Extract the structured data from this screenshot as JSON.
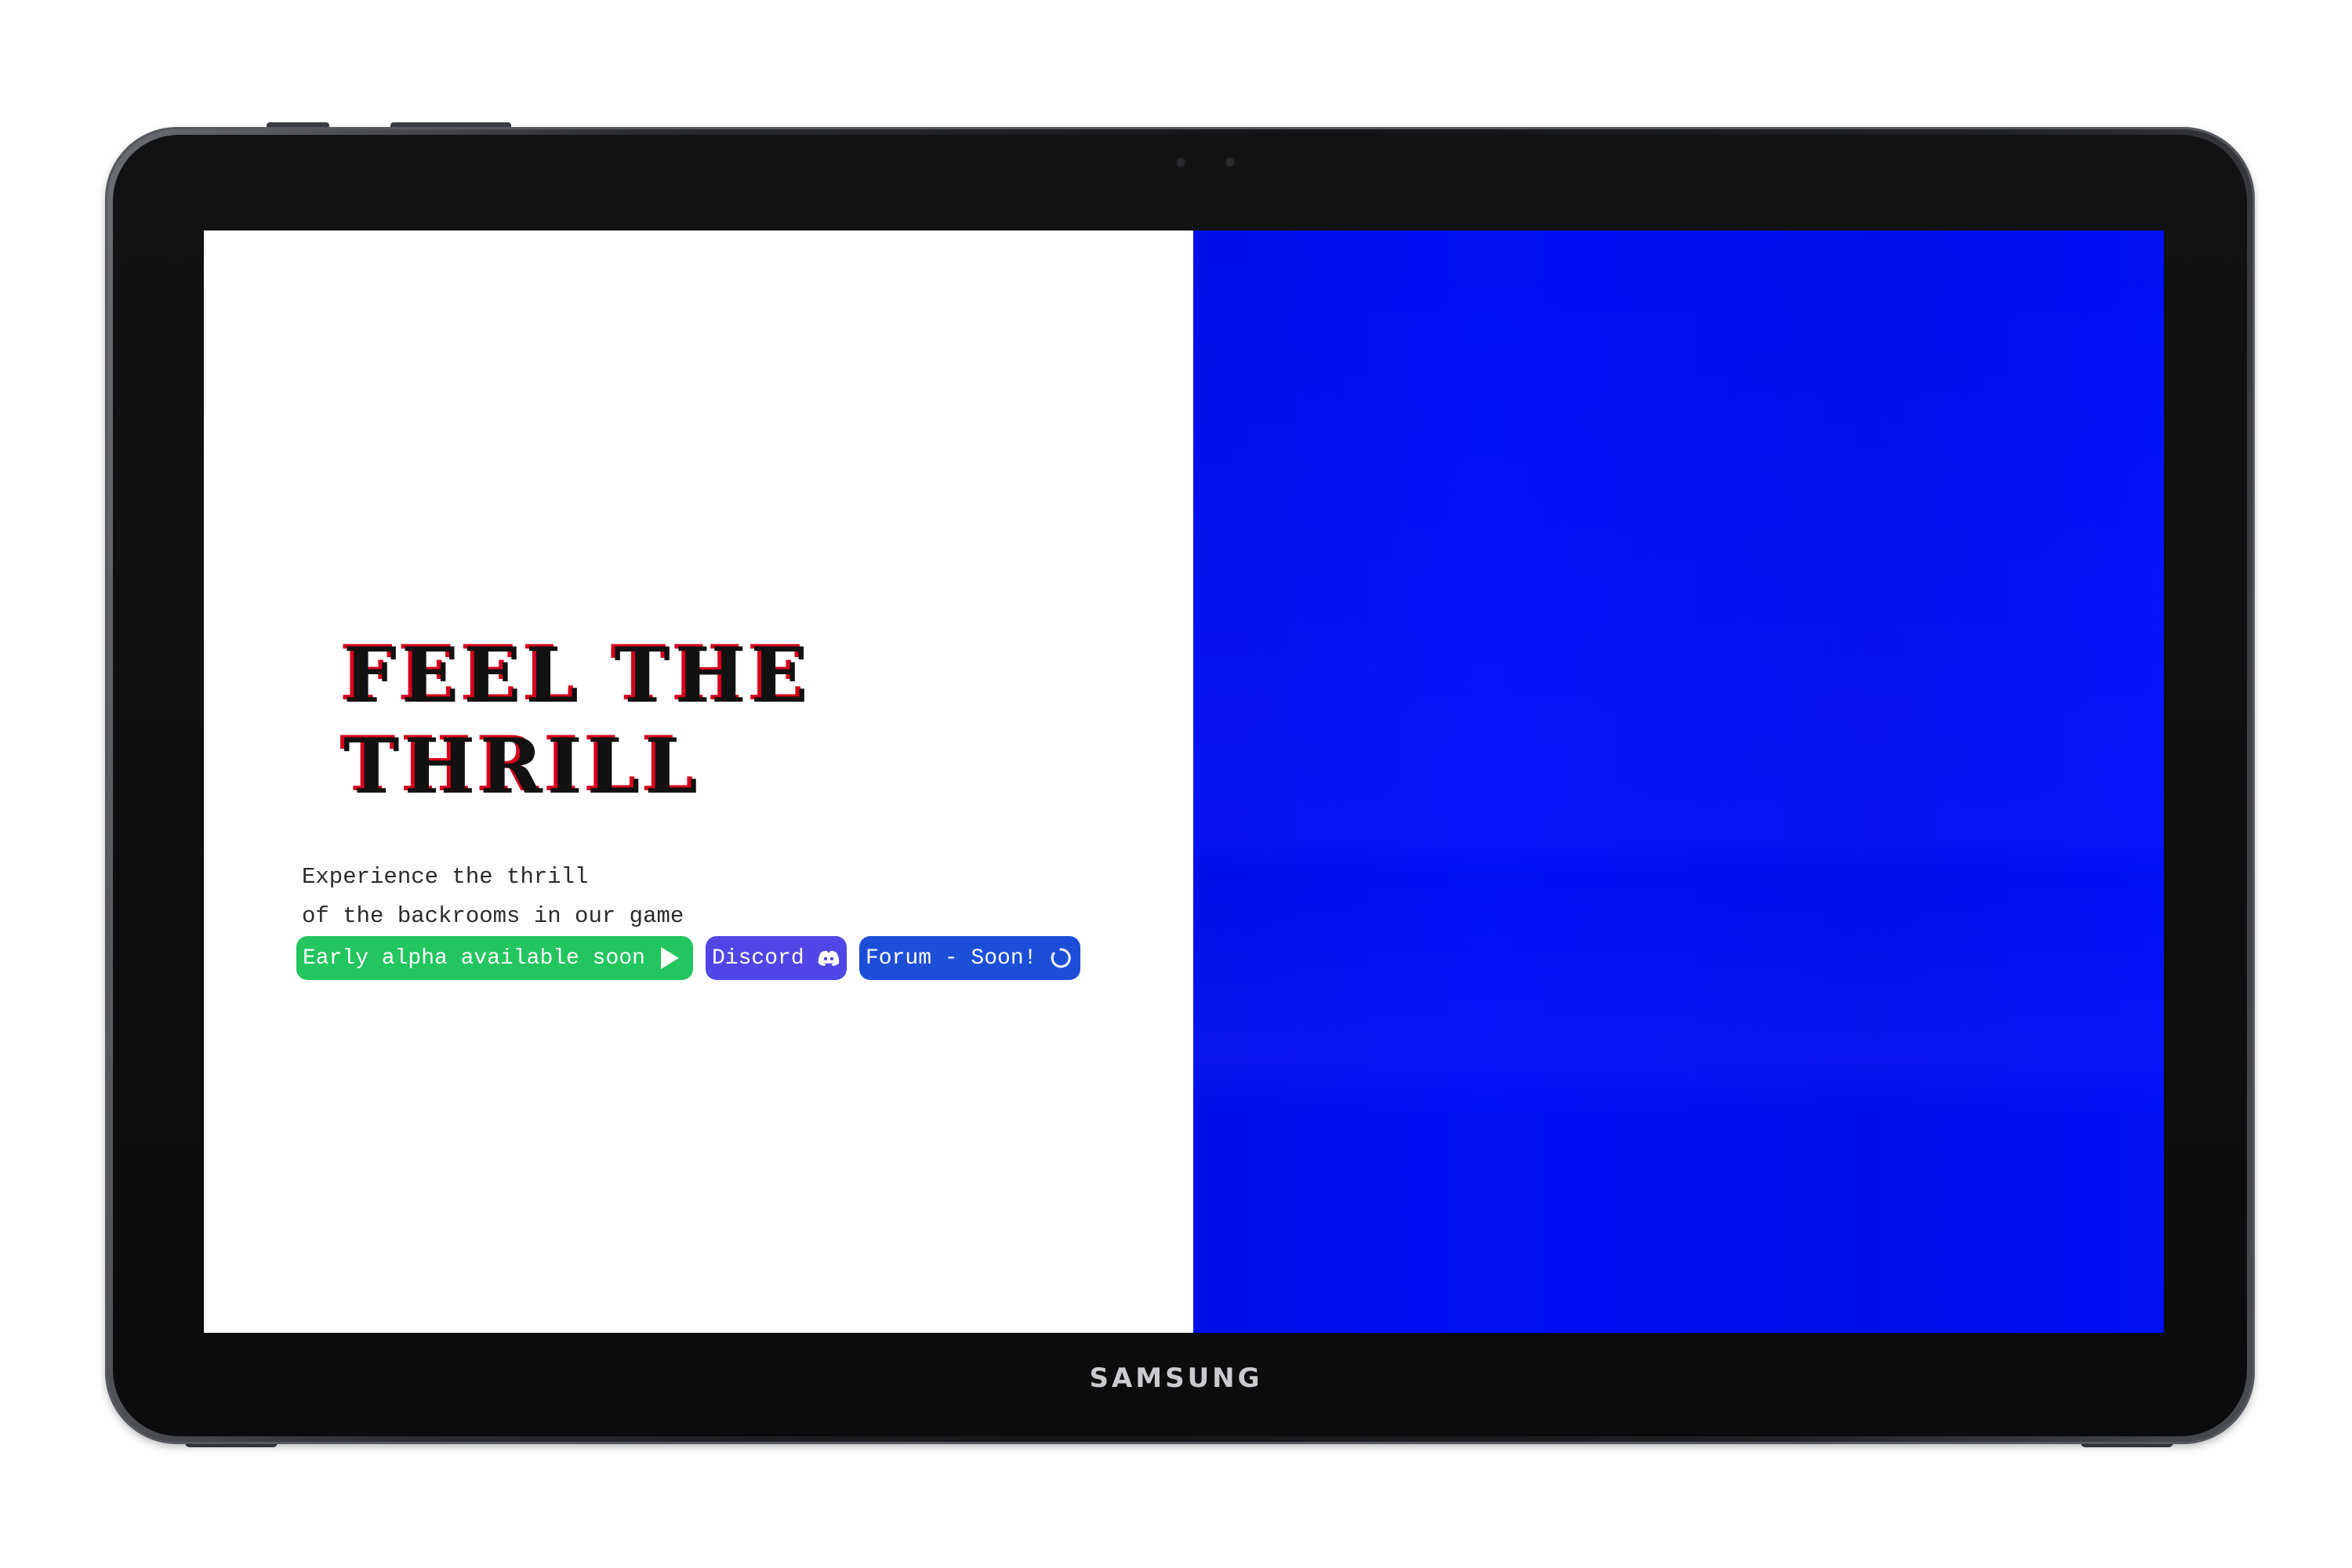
{
  "device": {
    "brand": "SAMSUNG"
  },
  "hero": {
    "title": "FEEL THE\nTHRILL",
    "tagline_line1": "Experience the thrill",
    "tagline_line2": "of the backrooms in our game"
  },
  "buttons": {
    "early_alpha": {
      "label": "Early alpha available soon",
      "icon": "play-icon",
      "color": "#22c55e"
    },
    "discord": {
      "label": "Discord",
      "icon": "discord-icon",
      "color": "#5046e5"
    },
    "forum": {
      "label": "Forum - Soon!",
      "icon": "loading-icon",
      "color": "#1d4ed8"
    }
  },
  "colors": {
    "right_panel": "#0010f5",
    "title_shadow": "#d6001c"
  }
}
